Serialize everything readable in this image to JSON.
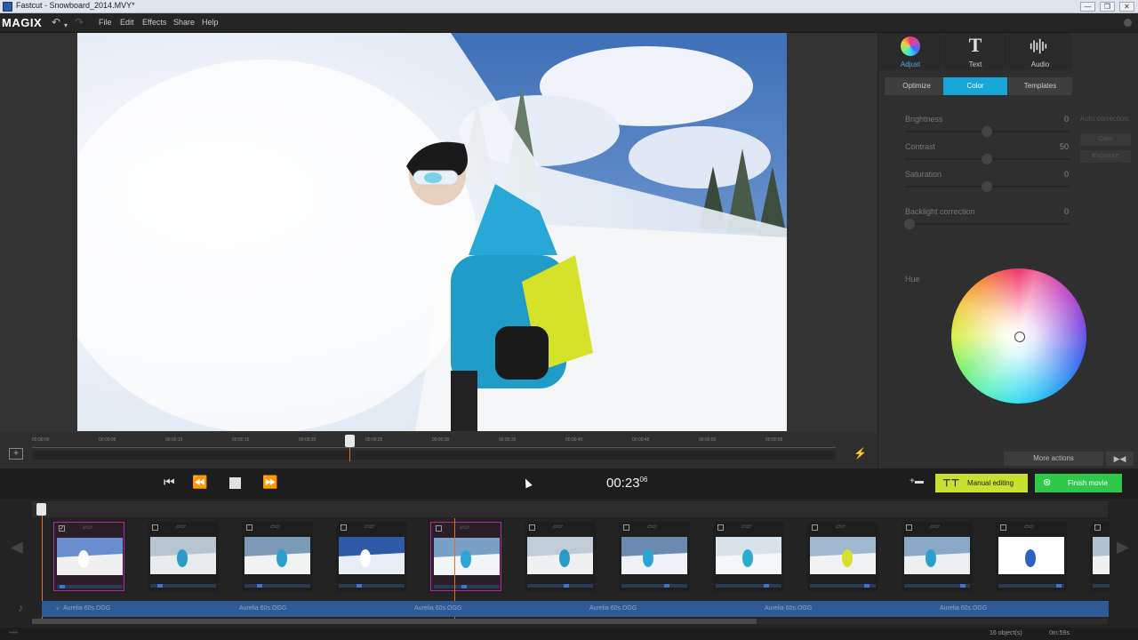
{
  "window": {
    "title": "Fastcut - Snowboard_2014.MVY*",
    "controls": [
      "—",
      "❐",
      "✕"
    ]
  },
  "menubar": {
    "logo": "MAGIX",
    "items": [
      "File",
      "Edit",
      "Effects",
      "Share",
      "Help"
    ]
  },
  "scrubber": {
    "ticks": [
      "00:00:00",
      "00:00:05",
      "00:00:10",
      "00:00:15",
      "00:00:20",
      "00:00:25",
      "00:00:30",
      "00:00:35",
      "00:00:40",
      "00:00:45",
      "00:00:50",
      "00:00:55"
    ]
  },
  "panel": {
    "tabs": [
      {
        "label": "Adjust",
        "icon": "color-ball-icon"
      },
      {
        "label": "Text",
        "icon": "text-icon"
      },
      {
        "label": "Audio",
        "icon": "waveform-icon"
      }
    ],
    "subtabs": [
      "Optimize",
      "Color",
      "Templates"
    ],
    "params": [
      {
        "label": "Brightness",
        "value": "0",
        "level": 0.5
      },
      {
        "label": "Contrast",
        "value": "50",
        "level": 0.5
      },
      {
        "label": "Saturation",
        "value": "0",
        "level": 0.5
      },
      {
        "label": "Backlight correction",
        "value": "0",
        "level": 0.0
      }
    ],
    "auto_correction_label": "Auto correction:",
    "auto_buttons": [
      "Color",
      "Exposure"
    ],
    "hue_label": "Hue",
    "more_actions": "More actions"
  },
  "transport": {
    "timecode": "00:23",
    "timecode_frames": "06",
    "manual_editing": "Manual editing",
    "finish_movie": "Finish movie"
  },
  "timeline": {
    "clip_count": 12,
    "audio_clips": [
      "Aurelia 60s.OGG",
      "Aurelia 60s.OGG",
      "Aurelia 60s.OGG",
      "Aurelia 60s.OGG",
      "Aurelia 60s.OGG",
      "Aurelia 60s.OGG"
    ]
  },
  "status": {
    "objects": "16 object(s)",
    "duration": "0m:59s"
  },
  "colors": {
    "accent_blue": "#16a6d8",
    "manual_green": "#c8e030",
    "finish_green": "#2ec84a",
    "selection": "#b02a9a",
    "audio": "#2e5a96"
  }
}
